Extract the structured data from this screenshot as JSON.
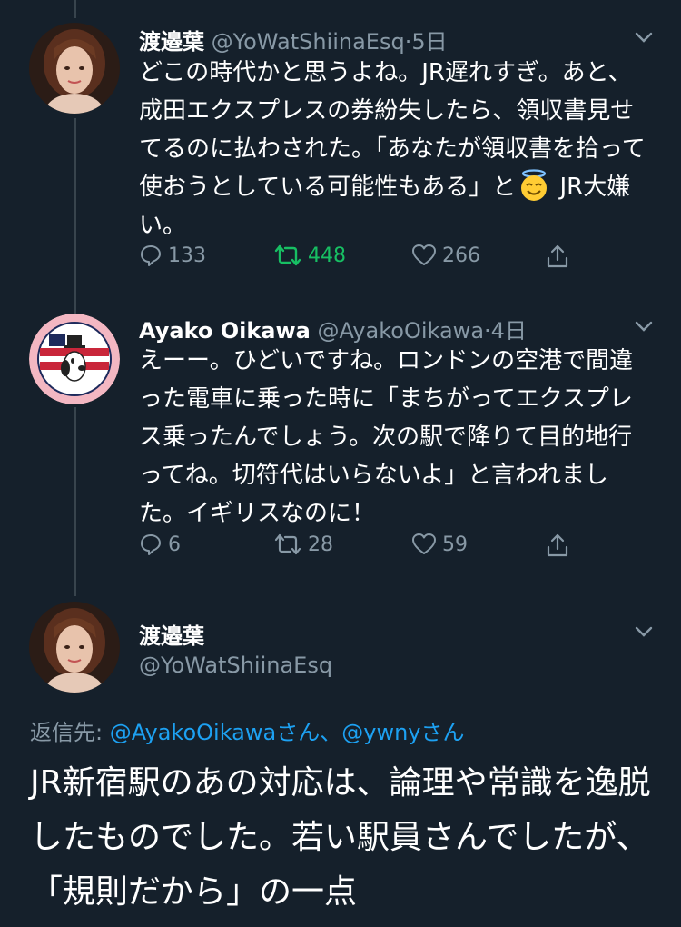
{
  "tweet1": {
    "display_name": "渡邉葉",
    "handle": "@YoWatShiinaEsq",
    "separator": "·",
    "time": "5日",
    "text_main": "どこの時代かと思うよね。JR遅れすぎ。あと、成田エクスプレスの券紛失したら、領収書見せてるのに払わされた。「あなたが領収書を拾って使おうとしている可能性もある」と",
    "emoji": "smiling-face-with-halo",
    "text_tail": " JR大嫌い。",
    "reply_count": "133",
    "retweet_count": "448",
    "like_count": "266"
  },
  "tweet2": {
    "display_name": "Ayako Oikawa",
    "handle": "@AyakoOikawa",
    "separator": "·",
    "time": "4日",
    "avatar_badge_text": "SNOOPY",
    "avatar_badge_sub": "FOR PRESIDENT",
    "text": "えーー。ひどいですね。ロンドンの空港で間違った電車に乗った時に「まちがってエクスプレス乗ったんでしょう。次の駅で降りて目的地行ってね。切符代はいらないよ」と言われました。イギリスなのに！",
    "reply_count": "6",
    "retweet_count": "28",
    "like_count": "59"
  },
  "tweet3": {
    "display_name": "渡邉葉",
    "handle": "@YoWatShiinaEsq",
    "reply_label": "返信先: ",
    "mention1": "@AyakoOikawa",
    "mention1_suffix": "さん、",
    "mention2": "@ywny",
    "mention2_suffix": "さん",
    "text": "JR新宿駅のあの対応は、論理や常識を逸脱したものでした。若い駅員さんでしたが、「規則だから」の一点"
  },
  "colors": {
    "background": "#15202b",
    "muted": "#8899a6",
    "accent": "#1da1f2",
    "retweet_green": "#17bf63",
    "thread_line": "#38444d"
  }
}
